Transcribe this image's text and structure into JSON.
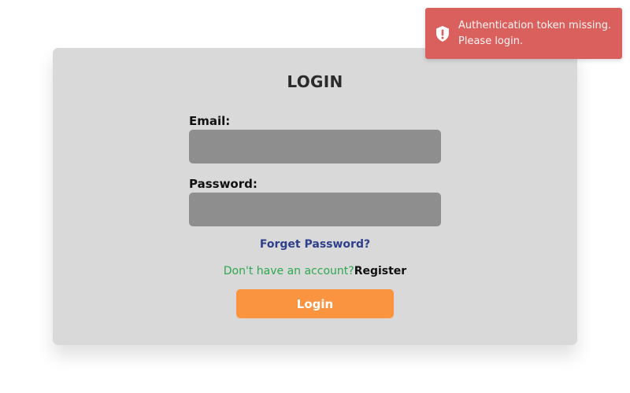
{
  "login_form": {
    "title": "LOGIN",
    "email_label": "Email:",
    "email_value": "",
    "password_label": "Password:",
    "password_value": "",
    "forgot_password": "Forget Password?",
    "register_prompt": "Don't have an account?",
    "register_link": "Register",
    "submit_label": "Login"
  },
  "toast": {
    "message": "Authentication token missing. Please login.",
    "icon": "shield-alert-icon"
  },
  "colors": {
    "card_background": "#d9d9d9",
    "input_background": "#8e8e8e",
    "forgot_link": "#2e3f8c",
    "register_prompt": "#2fa84f",
    "login_button": "#fb9440",
    "toast_background": "#d9605d"
  }
}
